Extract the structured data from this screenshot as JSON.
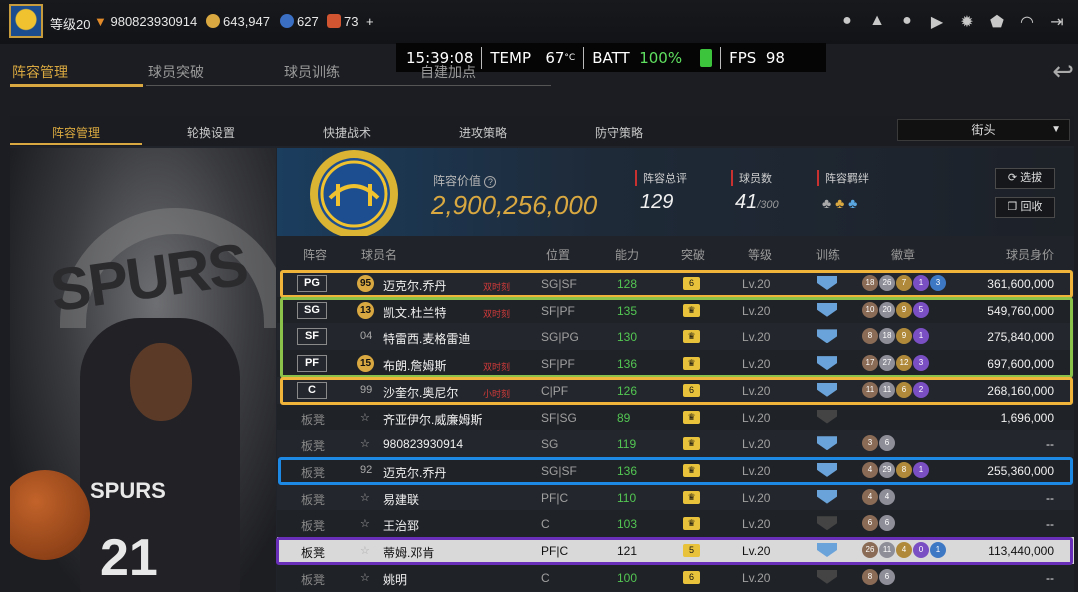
{
  "topbar": {
    "level": "等级20",
    "user_id": "980823930914",
    "coins": "643,947",
    "points": "627",
    "tickets": "73",
    "add": "+"
  },
  "hud": {
    "time": "15:39:08",
    "temp_label": "TEMP",
    "temp_value": "67",
    "temp_unit": "°C",
    "batt_label": "BATT",
    "batt_value": "100%",
    "fps_label": "FPS",
    "fps_value": "98"
  },
  "main_tabs": [
    "阵容管理",
    "球员突破",
    "球员训练",
    "自建加点"
  ],
  "sub_tabs": [
    "阵容管理",
    "轮换设置",
    "快捷战术",
    "进攻策略",
    "防守策略"
  ],
  "dropdown": {
    "value": "街头"
  },
  "summary": {
    "value_label": "阵容价值",
    "value": "2,900,256,000",
    "rating_label": "阵容总评",
    "rating": "129",
    "count_label": "球员数",
    "count": "41",
    "count_max": "/300",
    "bond_label": "阵容羁绊",
    "btn_select": "选拔",
    "btn_recycle": "回收"
  },
  "table": {
    "headers": [
      "阵容",
      "球员名",
      "位置",
      "能力",
      "突破",
      "等级",
      "训练",
      "徽章",
      "球员身价"
    ],
    "rows": [
      {
        "slot": "PG",
        "ovr": "95",
        "name": "迈克尔.乔丹",
        "moment": "双时刻",
        "pos": "SG|SF",
        "rating": "128",
        "brk": "6",
        "level": "Lv.20",
        "badges": [
          "18",
          "26",
          "7",
          "1",
          "3"
        ],
        "value": "361,600,000"
      },
      {
        "slot": "SG",
        "ovr": "13",
        "name": "凯文.杜兰特",
        "moment": "双时刻",
        "pos": "SF|PF",
        "rating": "135",
        "brk": "",
        "level": "Lv.20",
        "badges": [
          "10",
          "20",
          "9",
          "5"
        ],
        "value": "549,760,000"
      },
      {
        "slot": "SF",
        "ovr": "04",
        "name": "特雷西.麦格雷迪",
        "moment": "",
        "pos": "SG|PG",
        "rating": "130",
        "brk": "",
        "level": "Lv.20",
        "badges": [
          "8",
          "18",
          "9",
          "1"
        ],
        "value": "275,840,000"
      },
      {
        "slot": "PF",
        "ovr": "15",
        "name": "布朗.詹姆斯",
        "moment": "双时刻",
        "pos": "SF|PF",
        "rating": "136",
        "brk": "",
        "level": "Lv.20",
        "badges": [
          "17",
          "27",
          "12",
          "3"
        ],
        "value": "697,600,000"
      },
      {
        "slot": "C",
        "ovr": "99",
        "name": "沙奎尔.奥尼尔",
        "moment": "小时刻",
        "pos": "C|PF",
        "rating": "126",
        "brk": "6",
        "level": "Lv.20",
        "badges": [
          "11",
          "11",
          "6",
          "2"
        ],
        "value": "268,160,000"
      },
      {
        "slot": "板凳",
        "ovr": "",
        "name": "齐亚伊尔.威廉姆斯",
        "moment": "",
        "pos": "SF|SG",
        "rating": "89",
        "brk": "",
        "level": "Lv.20",
        "badges": [],
        "value": "1,696,000"
      },
      {
        "slot": "板凳",
        "ovr": "",
        "name": "980823930914",
        "moment": "",
        "pos": "SG",
        "rating": "119",
        "brk": "",
        "level": "Lv.20",
        "badges": [
          "3",
          "6"
        ],
        "value": "--"
      },
      {
        "slot": "板凳",
        "ovr": "92",
        "name": "迈克尔.乔丹",
        "moment": "",
        "pos": "SG|SF",
        "rating": "136",
        "brk": "",
        "level": "Lv.20",
        "badges": [
          "4",
          "29",
          "8",
          "1"
        ],
        "value": "255,360,000"
      },
      {
        "slot": "板凳",
        "ovr": "",
        "name": "易建联",
        "moment": "",
        "pos": "PF|C",
        "rating": "110",
        "brk": "",
        "level": "Lv.20",
        "badges": [
          "4",
          "4"
        ],
        "value": "--"
      },
      {
        "slot": "板凳",
        "ovr": "",
        "name": "王治郅",
        "moment": "",
        "pos": "C",
        "rating": "103",
        "brk": "",
        "level": "Lv.20",
        "badges": [
          "6",
          "6"
        ],
        "value": "--"
      },
      {
        "slot": "板凳",
        "ovr": "",
        "name": "蒂姆.邓肯",
        "moment": "",
        "pos": "PF|C",
        "rating": "121",
        "brk": "5",
        "level": "Lv.20",
        "badges": [
          "26",
          "11",
          "4",
          "0",
          "1"
        ],
        "value": "113,440,000"
      },
      {
        "slot": "板凳",
        "ovr": "",
        "name": "姚明",
        "moment": "",
        "pos": "C",
        "rating": "100",
        "brk": "6",
        "level": "Lv.20",
        "badges": [
          "8",
          "6"
        ],
        "value": "--"
      }
    ]
  },
  "art": {
    "team_word": "SPURS",
    "jersey_team": "SPURS",
    "jersey_number": "21"
  },
  "colors": {
    "accent": "#d9a840",
    "green": "#53c653",
    "yellow_outline": "#f0b43a",
    "green_outline": "#8bc34a",
    "blue_outline": "#1e88e5",
    "purple_outline": "#6a2fb8"
  }
}
